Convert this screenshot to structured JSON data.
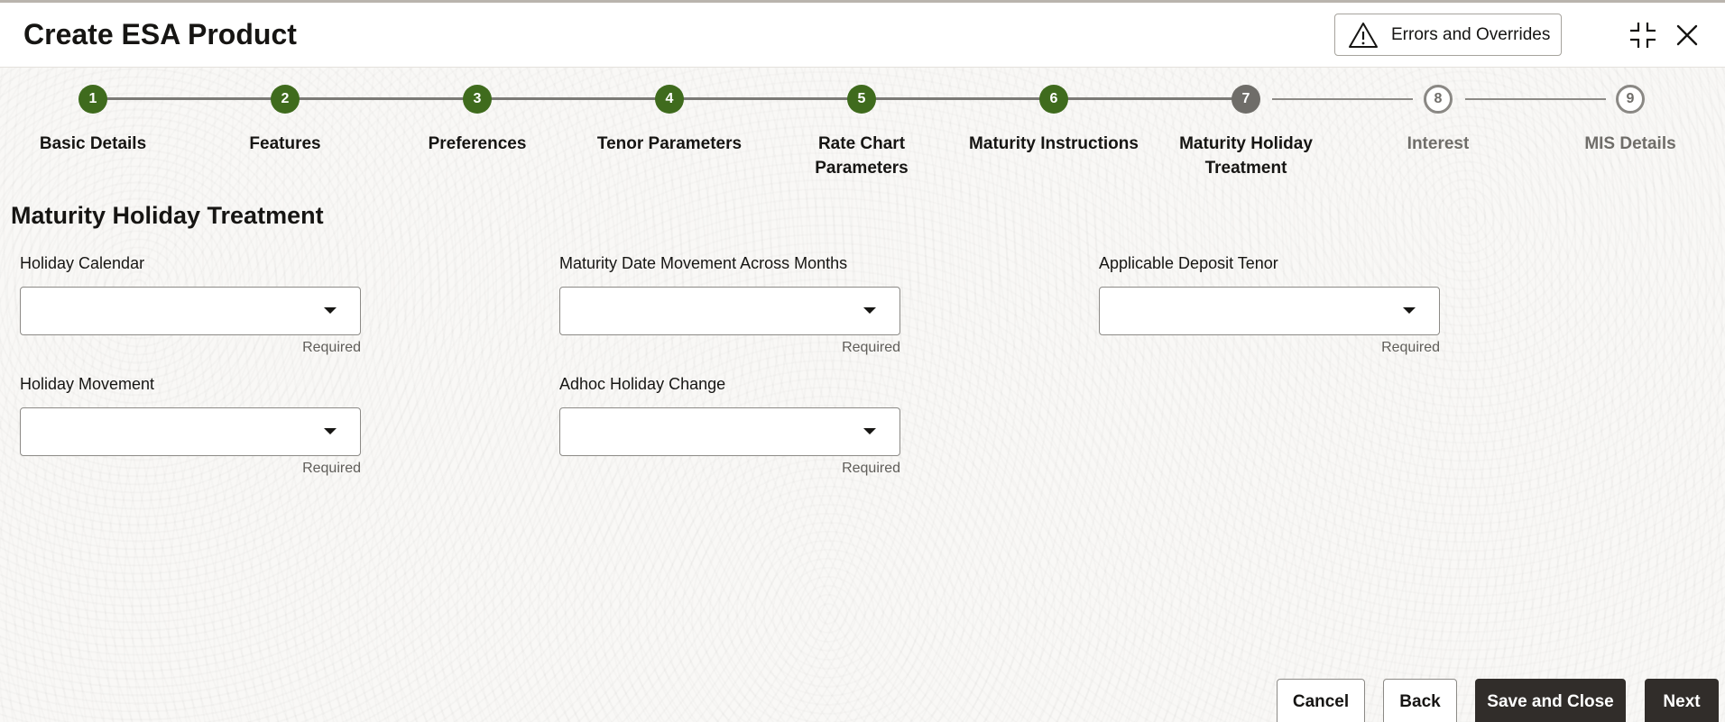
{
  "header": {
    "title": "Create ESA Product",
    "errors_button_label": "Errors and Overrides"
  },
  "train": {
    "steps": [
      {
        "number": "1",
        "label": "Basic Details",
        "status": "done"
      },
      {
        "number": "2",
        "label": "Features",
        "status": "done"
      },
      {
        "number": "3",
        "label": "Preferences",
        "status": "done"
      },
      {
        "number": "4",
        "label": "Tenor Parameters",
        "status": "done"
      },
      {
        "number": "5",
        "label": "Rate Chart Parameters",
        "status": "done"
      },
      {
        "number": "6",
        "label": "Maturity Instructions",
        "status": "done"
      },
      {
        "number": "7",
        "label": "Maturity Holiday Treatment",
        "status": "current"
      },
      {
        "number": "8",
        "label": "Interest",
        "status": "todo"
      },
      {
        "number": "9",
        "label": "MIS Details",
        "status": "todo"
      }
    ]
  },
  "section": {
    "title": "Maturity Holiday Treatment"
  },
  "fields": {
    "holiday_calendar": {
      "label": "Holiday Calendar",
      "value": "",
      "hint": "Required"
    },
    "maturity_date_movement": {
      "label": "Maturity Date Movement Across Months",
      "value": "",
      "hint": "Required"
    },
    "applicable_deposit_tenor": {
      "label": "Applicable Deposit Tenor",
      "value": "",
      "hint": "Required"
    },
    "holiday_movement": {
      "label": "Holiday Movement",
      "value": "",
      "hint": "Required"
    },
    "adhoc_holiday_change": {
      "label": "Adhoc Holiday Change",
      "value": "",
      "hint": "Required"
    }
  },
  "footer": {
    "cancel_label": "Cancel",
    "back_label": "Back",
    "save_close_label": "Save and Close",
    "next_label": "Next"
  },
  "colors": {
    "done_step": "#3f6b1d",
    "current_step": "#6f6d69",
    "primary_button": "#312d2a"
  }
}
